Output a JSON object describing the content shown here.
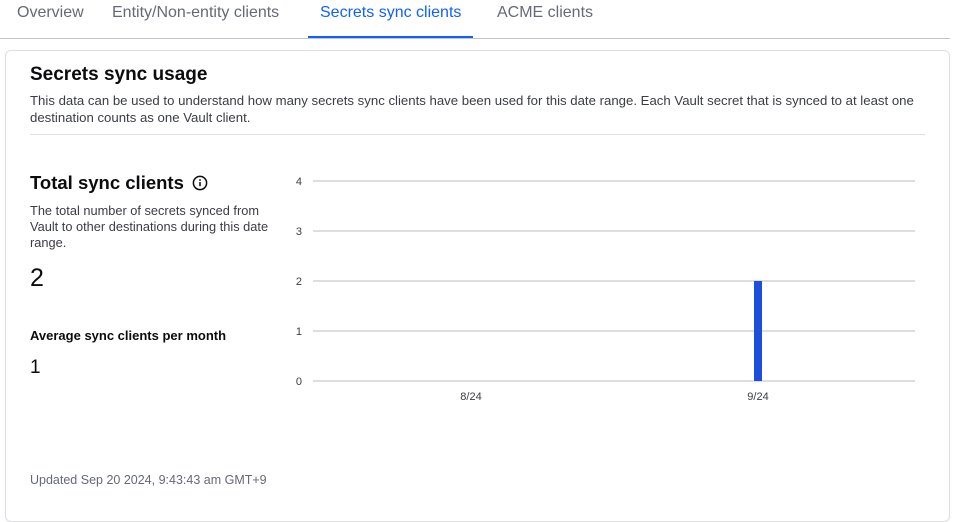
{
  "tabs": [
    {
      "label": "Overview",
      "active": false
    },
    {
      "label": "Entity/Non-entity clients",
      "active": false
    },
    {
      "label": "Secrets sync clients",
      "active": true
    },
    {
      "label": "ACME clients",
      "active": false
    }
  ],
  "card": {
    "title": "Secrets sync usage",
    "description": "This data can be used to understand how many secrets sync clients have been used for this date range. Each Vault secret that is synced to at least one destination counts as one Vault client."
  },
  "stats": {
    "total_title": "Total sync clients",
    "total_description": "The total number of secrets synced from Vault to other destinations during this date range.",
    "total_value": "2",
    "average_label": "Average sync clients per month",
    "average_value": "1"
  },
  "updated": "Updated Sep 20 2024, 9:43:43 am GMT+9",
  "colors": {
    "accent": "#1060ff",
    "bar": "#1c4fdb"
  },
  "chart_data": {
    "type": "bar",
    "categories": [
      "8/24",
      "9/24"
    ],
    "values": [
      0,
      2
    ],
    "ylim": [
      0,
      4
    ],
    "yticks": [
      0,
      1,
      2,
      3,
      4
    ],
    "grid": true,
    "title": "",
    "xlabel": "",
    "ylabel": ""
  }
}
